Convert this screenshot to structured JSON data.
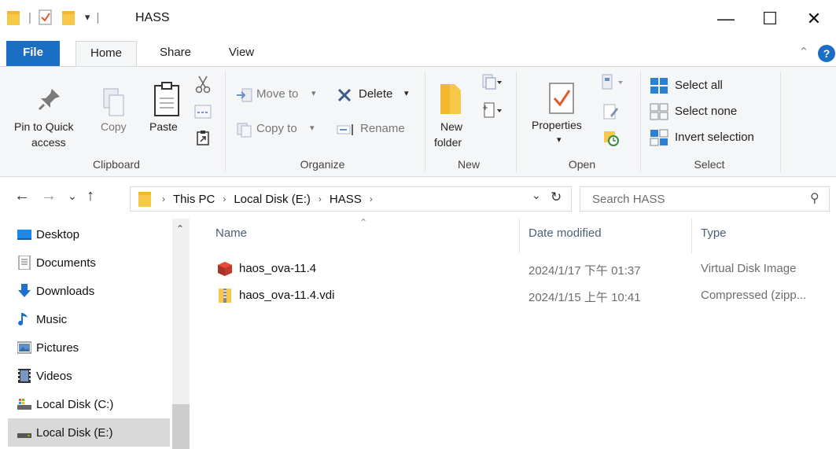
{
  "window": {
    "title": "HASS",
    "minimize_glyph": "—",
    "maximize_glyph": "☐",
    "close_glyph": "✕",
    "qa_divider": "|",
    "qa_dropdown_glyph": "▾"
  },
  "tabs": {
    "file": "File",
    "home": "Home",
    "share": "Share",
    "view": "View",
    "collapse_glyph": "⌃",
    "help_glyph": "?"
  },
  "ribbon": {
    "clipboard": {
      "pin": "Pin to Quick",
      "pin_line2": "access",
      "copy": "Copy",
      "paste": "Paste",
      "label": "Clipboard"
    },
    "organize": {
      "move_to": "Move to",
      "copy_to": "Copy to",
      "delete": "Delete",
      "rename": "Rename",
      "label": "Organize",
      "dropdown_glyph": "▾"
    },
    "new": {
      "new_folder": "New",
      "new_folder_line2": "folder",
      "label": "New"
    },
    "open": {
      "properties": "Properties",
      "label": "Open",
      "dropdown_glyph": "▾"
    },
    "select": {
      "select_all": "Select all",
      "select_none": "Select none",
      "invert": "Invert selection",
      "label": "Select"
    }
  },
  "address": {
    "back_glyph": "←",
    "forward_glyph": "→",
    "recent_glyph": "⌄",
    "up_glyph": "↑",
    "separator": "›",
    "crumbs": [
      "This PC",
      "Local Disk (E:)",
      "HASS"
    ],
    "history_glyph": "⌄",
    "refresh_glyph": "↻",
    "search_placeholder": "Search HASS",
    "search_glyph": "⚲"
  },
  "nav": {
    "scroll_up_glyph": "⌃",
    "items": [
      {
        "label": "Desktop"
      },
      {
        "label": "Documents"
      },
      {
        "label": "Downloads"
      },
      {
        "label": "Music"
      },
      {
        "label": "Pictures"
      },
      {
        "label": "Videos"
      },
      {
        "label": "Local Disk (C:)"
      },
      {
        "label": "Local Disk (E:)"
      }
    ]
  },
  "files": {
    "sort_glyph": "⌃",
    "columns": {
      "name": "Name",
      "date": "Date modified",
      "type": "Type"
    },
    "rows": [
      {
        "name": "haos_ova-11.4",
        "date": "2024/1/17 下午 01:37",
        "type": "Virtual Disk Image"
      },
      {
        "name": "haos_ova-11.4.vdi",
        "date": "2024/1/15 上午 10:41",
        "type": "Compressed (zipp..."
      }
    ]
  },
  "colors": {
    "file_tab": "#1a6fc4",
    "ribbon_bg": "#f5f6f7",
    "selected_nav": "#d9d9d9",
    "folder": "#f7c948"
  }
}
